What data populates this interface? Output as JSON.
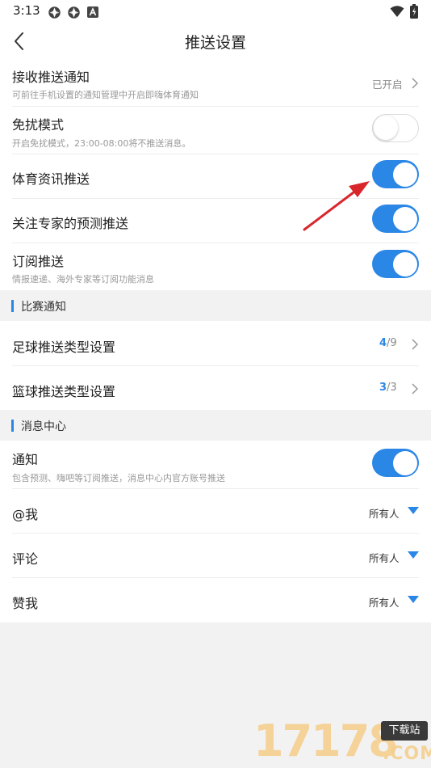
{
  "status_bar": {
    "time": "3:13"
  },
  "header": {
    "title": "推送设置"
  },
  "settings": {
    "receive_push": {
      "title": "接收推送通知",
      "subtitle": "可前往手机设置的通知管理中开启即嗨体育通知",
      "value": "已开启"
    },
    "dnd": {
      "title": "免扰模式",
      "subtitle": "开启免扰模式，23:00-08:00将不推送消息。",
      "enabled": false
    },
    "sports_news": {
      "title": "体育资讯推送",
      "enabled": true
    },
    "expert_forecast": {
      "title": "关注专家的预测推送",
      "enabled": true
    },
    "subscription": {
      "title": "订阅推送",
      "subtitle": "情报速递、海外专家等订阅功能消息",
      "enabled": true
    }
  },
  "match_section": {
    "title": "比赛通知",
    "football": {
      "title": "足球推送类型设置",
      "selected": "4",
      "total": "/9"
    },
    "basketball": {
      "title": "篮球推送类型设置",
      "selected": "3",
      "total": "/3"
    }
  },
  "message_section": {
    "title": "消息中心",
    "notify": {
      "title": "通知",
      "subtitle": "包含预测、嗨吧等订阅推送，消息中心内官方账号推送",
      "enabled": true
    },
    "mention": {
      "title": "@我",
      "value": "所有人"
    },
    "comment": {
      "title": "评论",
      "value": "所有人"
    },
    "like": {
      "title": "赞我",
      "value": "所有人"
    }
  },
  "watermark": {
    "digits": "17178",
    "tag": "下载站",
    "domain": ".COM"
  },
  "colors": {
    "accent": "#2b87e6",
    "arrow": "#d9262b"
  }
}
